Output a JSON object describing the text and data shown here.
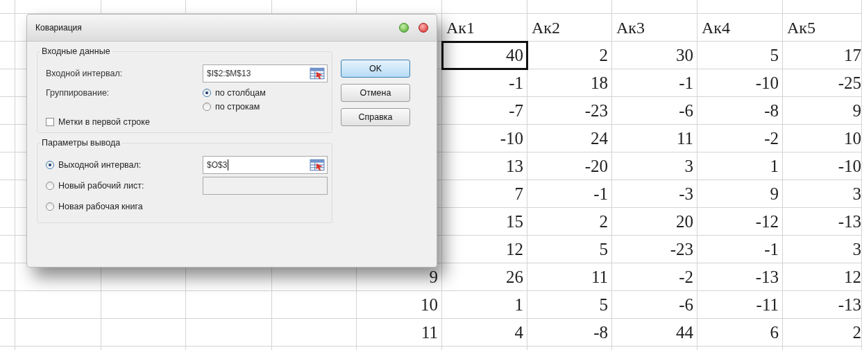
{
  "dialog": {
    "title": "Ковариация",
    "input_group": {
      "title": "Входные данные",
      "range_label": "Входной интервал:",
      "range_value": "$I$2:$M$13",
      "grouping_label": "Группирование:",
      "grouping_options": [
        {
          "label": "по столбцам",
          "selected": true
        },
        {
          "label": "по строкам",
          "selected": false
        }
      ],
      "labels_checkbox": {
        "label": "Метки в первой строке",
        "checked": false
      }
    },
    "output_group": {
      "title": "Параметры вывода",
      "options": [
        {
          "label": "Выходной интервал:",
          "selected": true,
          "kind": "range",
          "value": "$O$3",
          "disabled": false
        },
        {
          "label": "Новый рабочий лист:",
          "selected": false,
          "kind": "text",
          "disabled": true
        },
        {
          "label": "Новая рабочая книга",
          "selected": false,
          "kind": "plain"
        }
      ]
    },
    "buttons": [
      {
        "label": "OK",
        "default": true
      },
      {
        "label": "Отмена",
        "default": false
      },
      {
        "label": "Справка",
        "default": false
      }
    ]
  },
  "sheet": {
    "headers": [
      "Ак1",
      "Ак2",
      "Ак3",
      "Ак4",
      "Ак5"
    ],
    "rows": [
      {
        "values": [
          "40",
          "2",
          "30",
          "5",
          "17"
        ],
        "selected_first": true
      },
      {
        "values": [
          "-1",
          "18",
          "-1",
          "-10",
          "-25"
        ],
        "selected_first": false
      },
      {
        "values": [
          "-7",
          "-23",
          "-6",
          "-8",
          "9"
        ],
        "selected_first": false
      },
      {
        "values": [
          "-10",
          "24",
          "11",
          "-2",
          "10"
        ],
        "selected_first": false
      },
      {
        "values": [
          "13",
          "-20",
          "3",
          "1",
          "-10"
        ],
        "selected_first": false
      },
      {
        "values": [
          "7",
          "-1",
          "-3",
          "9",
          "3"
        ],
        "selected_first": false
      },
      {
        "values": [
          "15",
          "2",
          "20",
          "-12",
          "-13"
        ],
        "selected_first": false
      },
      {
        "values": [
          "12",
          "5",
          "-23",
          "-1",
          "3"
        ],
        "selected_first": false
      },
      {
        "index": "9",
        "values": [
          "26",
          "11",
          "-2",
          "-13",
          "12"
        ],
        "selected_first": false
      },
      {
        "index": "10",
        "values": [
          "1",
          "5",
          "-6",
          "-11",
          "-13"
        ],
        "selected_first": false
      },
      {
        "index": "11",
        "values": [
          "4",
          "-8",
          "44",
          "6",
          "2"
        ],
        "selected_first": false
      }
    ]
  }
}
